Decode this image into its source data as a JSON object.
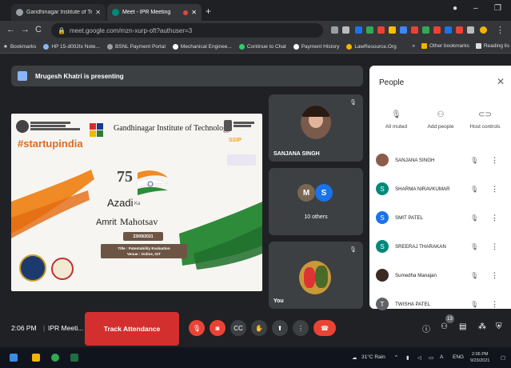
{
  "browser": {
    "tabs": [
      {
        "label": "Gandhinagar Institute of Technol",
        "active": false
      },
      {
        "label": "Meet - IPR Meeting",
        "active": true
      }
    ],
    "new_tab": "+",
    "url": "meet.google.com/mzn-xurp-oft?authuser=3",
    "window_controls": [
      "●",
      "–",
      "❐"
    ]
  },
  "bookmarks": {
    "items": [
      {
        "label": "Bookmarks"
      },
      {
        "label": "HP 15-d002tx Note..."
      },
      {
        "label": "BSNL Payment Portal"
      },
      {
        "label": "Mechanical Enginee..."
      },
      {
        "label": "Continue to Chat"
      },
      {
        "label": "Payment History"
      },
      {
        "label": "LawResource.Org"
      }
    ],
    "overflow": "»",
    "other": "Other bookmarks",
    "reading": "Reading lis"
  },
  "meet": {
    "presenting_text": "Mrugesh Khatri is presenting",
    "slide": {
      "institute": "Gandhinagar Institute of Technology",
      "hashtag": "#startupindia",
      "ssip": "SSIP",
      "big_number": "75",
      "azadi": "Azadi",
      "ka": "Ka",
      "amrit": "Amrit",
      "mahotsav": "Mahotsav",
      "date": "23/09/2021",
      "title_line": "Title : Patentability Evaluation",
      "venue_line": "Venue : Online, GIT"
    },
    "tiles": {
      "sanjana": "SANJANA SINGH",
      "others_label": "10 others",
      "others_initials": [
        "M",
        "S"
      ],
      "you": "You"
    }
  },
  "people_panel": {
    "title": "People",
    "close": "✕",
    "actions": [
      {
        "label": "All muted",
        "icon": "mic-off-icon"
      },
      {
        "label": "Add people",
        "icon": "add-person-icon"
      },
      {
        "label": "Host controls",
        "icon": "toggle-icon"
      }
    ],
    "participants": [
      {
        "name": "SANJANA SINGH",
        "initial": "",
        "color": "#8a5d4a"
      },
      {
        "name": "SHARMA NIRAVKUMAR",
        "initial": "S",
        "color": "#00897b"
      },
      {
        "name": "SMIT PATEL",
        "initial": "S",
        "color": "#1a73e8"
      },
      {
        "name": "SREERAJ THARAKAN",
        "initial": "S",
        "color": "#00897b"
      },
      {
        "name": "Sumedha Manajan",
        "initial": "",
        "color": "#3a2a22"
      },
      {
        "name": "TWISHA PATEL",
        "initial": "T",
        "color": "#5f6368"
      }
    ]
  },
  "controls": {
    "time": "2:06 PM",
    "separator": "|",
    "meeting": "IPR Meeti...",
    "track_attendance": "Track Attendance",
    "people_count": "13"
  },
  "taskbar": {
    "weather": "31°C Rain",
    "lang": "ENG",
    "clock_time": "2:06 PM",
    "clock_date": "9/23/2021"
  }
}
